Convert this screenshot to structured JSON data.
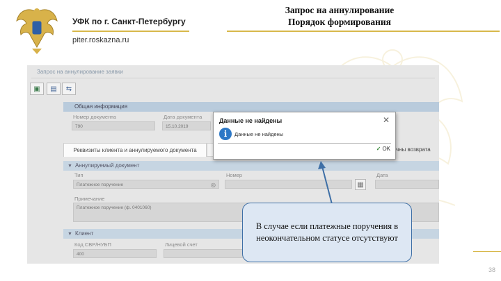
{
  "header": {
    "org_name": "УФК по г. Санкт-Петербургу",
    "website": "piter.roskazna.ru",
    "slide_title_line1": "Запрос на аннулирование",
    "slide_title_line2": "Порядок формирования",
    "page_number": "38"
  },
  "app": {
    "window_title": "Запрос на аннулирование заявки",
    "toolbar": [
      {
        "icon": "save-icon"
      },
      {
        "icon": "document-icon"
      },
      {
        "icon": "attach-icon"
      }
    ],
    "general_section": {
      "title": "Общая информация",
      "doc_number_label": "Номер документа",
      "doc_number_value": "790",
      "doc_date_label": "Дата документа",
      "doc_date_value": "15.10.2019"
    },
    "tabs": [
      {
        "label": "Реквизиты клиента и аннулируемого документа"
      },
      {
        "label": "чны возврата"
      }
    ],
    "annulled_section": {
      "title": "Аннулируемый документ",
      "type_label": "Тип",
      "type_value": "Платежное поручение",
      "number_label": "Номер",
      "date_label": "Дата",
      "note_label": "Примечание",
      "note_value": "Платежное поручение (ф. 0401060)"
    },
    "client_section": {
      "title": "Клиент",
      "code_label": "Код СВР/НУБП",
      "code_value": "400",
      "account_label": "Лицевой счет"
    }
  },
  "dialog": {
    "title": "Данные не найдены",
    "message": "Данные не найдены",
    "ok_label": "OK",
    "icon": "info-icon"
  },
  "callout": {
    "text": "В случае если платежные поручения в неокончательном статусе отсутствуют"
  },
  "colors": {
    "accent_gold": "#d8b84a",
    "section_header": "#b9cbdc",
    "callout_fill": "#dde7f3",
    "callout_border": "#3e6fa6",
    "info_icon": "#2d78c6"
  }
}
